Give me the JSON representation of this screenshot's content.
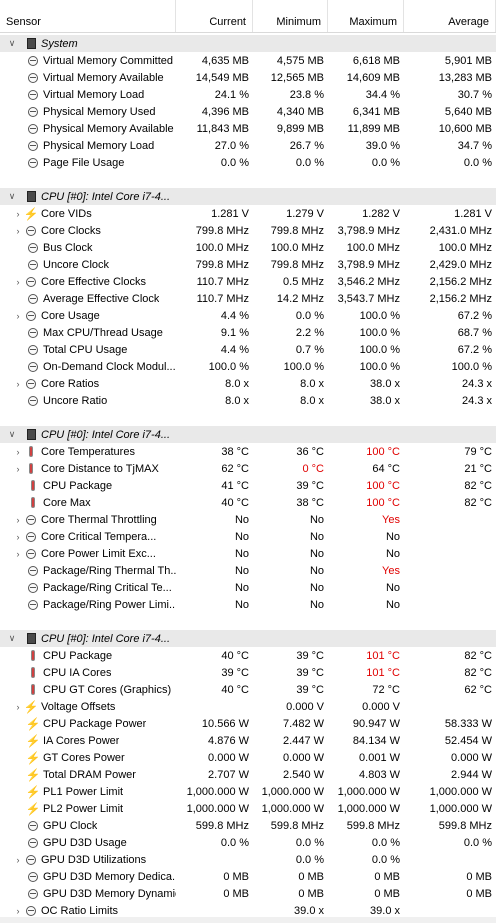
{
  "header": {
    "sensor": "Sensor",
    "current": "Current",
    "minimum": "Minimum",
    "maximum": "Maximum",
    "average": "Average"
  },
  "rows": [
    {
      "t": "group",
      "label": "System",
      "icon": "chip",
      "exp": "v"
    },
    {
      "label": "Virtual Memory Committed",
      "icon": "clock",
      "exp": "",
      "cur": "4,635 MB",
      "min": "4,575 MB",
      "max": "6,618 MB",
      "avg": "5,901 MB"
    },
    {
      "label": "Virtual Memory Available",
      "icon": "clock",
      "exp": "",
      "cur": "14,549 MB",
      "min": "12,565 MB",
      "max": "14,609 MB",
      "avg": "13,283 MB"
    },
    {
      "label": "Virtual Memory Load",
      "icon": "clock",
      "exp": "",
      "cur": "24.1 %",
      "min": "23.8 %",
      "max": "34.4 %",
      "avg": "30.7 %"
    },
    {
      "label": "Physical Memory Used",
      "icon": "clock",
      "exp": "",
      "cur": "4,396 MB",
      "min": "4,340 MB",
      "max": "6,341 MB",
      "avg": "5,640 MB"
    },
    {
      "label": "Physical Memory Available",
      "icon": "clock",
      "exp": "",
      "cur": "11,843 MB",
      "min": "9,899 MB",
      "max": "11,899 MB",
      "avg": "10,600 MB"
    },
    {
      "label": "Physical Memory Load",
      "icon": "clock",
      "exp": "",
      "cur": "27.0 %",
      "min": "26.7 %",
      "max": "39.0 %",
      "avg": "34.7 %"
    },
    {
      "label": "Page File Usage",
      "icon": "clock",
      "exp": "",
      "cur": "0.0 %",
      "min": "0.0 %",
      "max": "0.0 %",
      "avg": "0.0 %"
    },
    {
      "t": "blank"
    },
    {
      "t": "group",
      "label": "CPU [#0]: Intel Core i7-4...",
      "icon": "chip",
      "exp": "v"
    },
    {
      "label": "Core VIDs",
      "icon": "bolt",
      "exp": ">",
      "cur": "1.281 V",
      "min": "1.279 V",
      "max": "1.282 V",
      "avg": "1.281 V"
    },
    {
      "label": "Core Clocks",
      "icon": "clock",
      "exp": ">",
      "cur": "799.8 MHz",
      "min": "799.8 MHz",
      "max": "3,798.9 MHz",
      "avg": "2,431.0 MHz"
    },
    {
      "label": "Bus Clock",
      "icon": "clock",
      "exp": "",
      "cur": "100.0 MHz",
      "min": "100.0 MHz",
      "max": "100.0 MHz",
      "avg": "100.0 MHz"
    },
    {
      "label": "Uncore Clock",
      "icon": "clock",
      "exp": "",
      "cur": "799.8 MHz",
      "min": "799.8 MHz",
      "max": "3,798.9 MHz",
      "avg": "2,429.0 MHz"
    },
    {
      "label": "Core Effective Clocks",
      "icon": "clock",
      "exp": ">",
      "cur": "110.7 MHz",
      "min": "0.5 MHz",
      "max": "3,546.2 MHz",
      "avg": "2,156.2 MHz"
    },
    {
      "label": "Average Effective Clock",
      "icon": "clock",
      "exp": "",
      "cur": "110.7 MHz",
      "min": "14.2 MHz",
      "max": "3,543.7 MHz",
      "avg": "2,156.2 MHz"
    },
    {
      "label": "Core Usage",
      "icon": "clock",
      "exp": ">",
      "cur": "4.4 %",
      "min": "0.0 %",
      "max": "100.0 %",
      "avg": "67.2 %"
    },
    {
      "label": "Max CPU/Thread Usage",
      "icon": "clock",
      "exp": "",
      "cur": "9.1 %",
      "min": "2.2 %",
      "max": "100.0 %",
      "avg": "68.7 %"
    },
    {
      "label": "Total CPU Usage",
      "icon": "clock",
      "exp": "",
      "cur": "4.4 %",
      "min": "0.7 %",
      "max": "100.0 %",
      "avg": "67.2 %"
    },
    {
      "label": "On-Demand Clock Modul...",
      "icon": "clock",
      "exp": "",
      "cur": "100.0 %",
      "min": "100.0 %",
      "max": "100.0 %",
      "avg": "100.0 %"
    },
    {
      "label": "Core Ratios",
      "icon": "clock",
      "exp": ">",
      "cur": "8.0 x",
      "min": "8.0 x",
      "max": "38.0 x",
      "avg": "24.3 x"
    },
    {
      "label": "Uncore Ratio",
      "icon": "clock",
      "exp": "",
      "cur": "8.0 x",
      "min": "8.0 x",
      "max": "38.0 x",
      "avg": "24.3 x"
    },
    {
      "t": "blank"
    },
    {
      "t": "group",
      "label": "CPU [#0]: Intel Core i7-4...",
      "icon": "chip",
      "exp": "v"
    },
    {
      "label": "Core Temperatures",
      "icon": "therm",
      "exp": ">",
      "cur": "38 °C",
      "min": "36 °C",
      "max": "100 °C",
      "avg": "79 °C",
      "redmax": true
    },
    {
      "label": "Core Distance to TjMAX",
      "icon": "therm",
      "exp": ">",
      "cur": "62 °C",
      "min": "0 °C",
      "max": "64 °C",
      "avg": "21 °C",
      "redmin": true
    },
    {
      "label": "CPU Package",
      "icon": "therm",
      "exp": "",
      "cur": "41 °C",
      "min": "39 °C",
      "max": "100 °C",
      "avg": "82 °C",
      "redmax": true
    },
    {
      "label": "Core Max",
      "icon": "therm",
      "exp": "",
      "cur": "40 °C",
      "min": "38 °C",
      "max": "100 °C",
      "avg": "82 °C",
      "redmax": true
    },
    {
      "label": "Core Thermal Throttling",
      "icon": "clock",
      "exp": ">",
      "cur": "No",
      "min": "No",
      "max": "Yes",
      "avg": "",
      "redmax": true
    },
    {
      "label": "Core Critical Tempera...",
      "icon": "clock",
      "exp": ">",
      "cur": "No",
      "min": "No",
      "max": "No",
      "avg": ""
    },
    {
      "label": "Core Power Limit Exc...",
      "icon": "clock",
      "exp": ">",
      "cur": "No",
      "min": "No",
      "max": "No",
      "avg": ""
    },
    {
      "label": "Package/Ring Thermal Th...",
      "icon": "clock",
      "exp": "",
      "cur": "No",
      "min": "No",
      "max": "Yes",
      "avg": "",
      "redmax": true
    },
    {
      "label": "Package/Ring Critical Te...",
      "icon": "clock",
      "exp": "",
      "cur": "No",
      "min": "No",
      "max": "No",
      "avg": ""
    },
    {
      "label": "Package/Ring Power Limi...",
      "icon": "clock",
      "exp": "",
      "cur": "No",
      "min": "No",
      "max": "No",
      "avg": ""
    },
    {
      "t": "blank"
    },
    {
      "t": "group",
      "label": "CPU [#0]: Intel Core i7-4...",
      "icon": "chip",
      "exp": "v"
    },
    {
      "label": "CPU Package",
      "icon": "therm",
      "exp": "",
      "cur": "40 °C",
      "min": "39 °C",
      "max": "101 °C",
      "avg": "82 °C",
      "redmax": true
    },
    {
      "label": "CPU IA Cores",
      "icon": "therm",
      "exp": "",
      "cur": "39 °C",
      "min": "39 °C",
      "max": "101 °C",
      "avg": "82 °C",
      "redmax": true
    },
    {
      "label": "CPU GT Cores (Graphics)",
      "icon": "therm",
      "exp": "",
      "cur": "40 °C",
      "min": "39 °C",
      "max": "72 °C",
      "avg": "62 °C"
    },
    {
      "label": "Voltage Offsets",
      "icon": "bolt",
      "exp": ">",
      "cur": "",
      "min": "0.000 V",
      "max": "0.000 V",
      "avg": ""
    },
    {
      "label": "CPU Package Power",
      "icon": "bolt",
      "exp": "",
      "cur": "10.566 W",
      "min": "7.482 W",
      "max": "90.947 W",
      "avg": "58.333 W"
    },
    {
      "label": "IA Cores Power",
      "icon": "bolt",
      "exp": "",
      "cur": "4.876 W",
      "min": "2.447 W",
      "max": "84.134 W",
      "avg": "52.454 W"
    },
    {
      "label": "GT Cores Power",
      "icon": "bolt",
      "exp": "",
      "cur": "0.000 W",
      "min": "0.000 W",
      "max": "0.001 W",
      "avg": "0.000 W"
    },
    {
      "label": "Total DRAM Power",
      "icon": "bolt",
      "exp": "",
      "cur": "2.707 W",
      "min": "2.540 W",
      "max": "4.803 W",
      "avg": "2.944 W"
    },
    {
      "label": "PL1 Power Limit",
      "icon": "bolt",
      "exp": "",
      "cur": "1,000.000 W",
      "min": "1,000.000 W",
      "max": "1,000.000 W",
      "avg": "1,000.000 W"
    },
    {
      "label": "PL2 Power Limit",
      "icon": "bolt",
      "exp": "",
      "cur": "1,000.000 W",
      "min": "1,000.000 W",
      "max": "1,000.000 W",
      "avg": "1,000.000 W"
    },
    {
      "label": "GPU Clock",
      "icon": "clock",
      "exp": "",
      "cur": "599.8 MHz",
      "min": "599.8 MHz",
      "max": "599.8 MHz",
      "avg": "599.8 MHz"
    },
    {
      "label": "GPU D3D Usage",
      "icon": "clock",
      "exp": "",
      "cur": "0.0 %",
      "min": "0.0 %",
      "max": "0.0 %",
      "avg": "0.0 %"
    },
    {
      "label": "GPU D3D Utilizations",
      "icon": "clock",
      "exp": ">",
      "cur": "",
      "min": "0.0 %",
      "max": "0.0 %",
      "avg": ""
    },
    {
      "label": "GPU D3D Memory Dedica...",
      "icon": "clock",
      "exp": "",
      "cur": "0 MB",
      "min": "0 MB",
      "max": "0 MB",
      "avg": "0 MB"
    },
    {
      "label": "GPU D3D Memory Dynamic",
      "icon": "clock",
      "exp": "",
      "cur": "0 MB",
      "min": "0 MB",
      "max": "0 MB",
      "avg": "0 MB"
    },
    {
      "label": "OC Ratio Limits",
      "icon": "clock",
      "exp": ">",
      "cur": "",
      "min": "39.0 x",
      "max": "39.0 x",
      "avg": ""
    }
  ]
}
